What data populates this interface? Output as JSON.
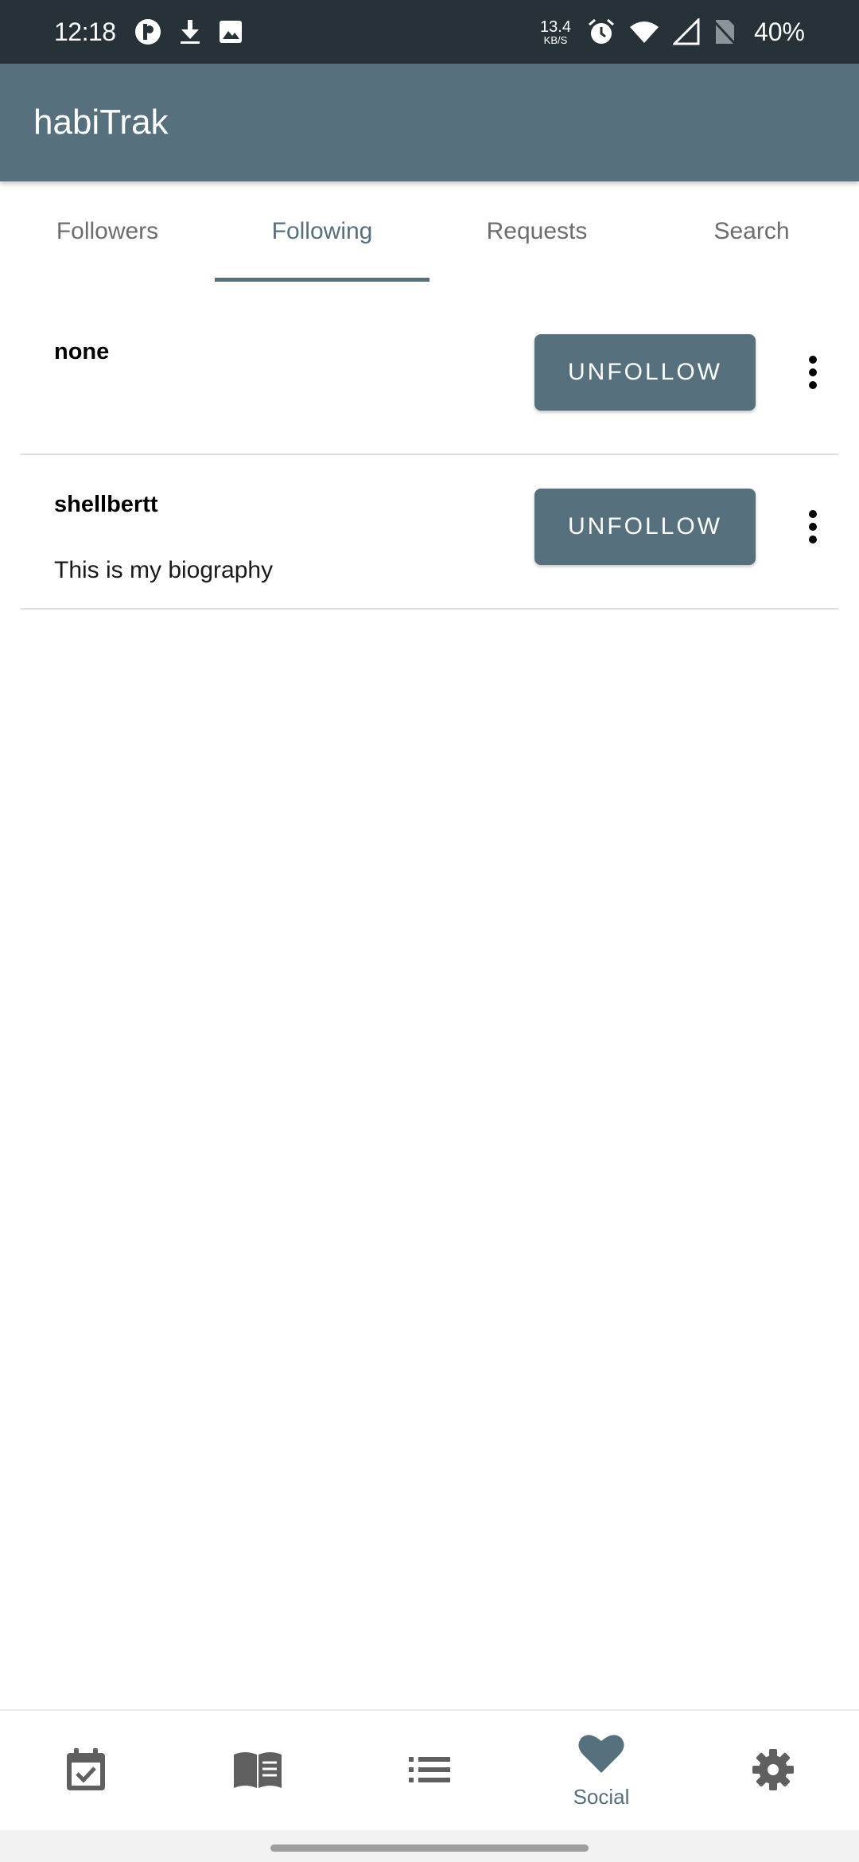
{
  "status_bar": {
    "time": "12:18",
    "net_speed_value": "13.4",
    "net_speed_unit": "KB/S",
    "battery": "40%",
    "icons": [
      "app-notification-icon",
      "download-icon",
      "image-icon",
      "alarm-icon",
      "wifi-icon",
      "signal-icon",
      "no-sim-icon"
    ]
  },
  "app_bar": {
    "title": "habiTrak"
  },
  "tabs": [
    {
      "label": "Followers",
      "active": false
    },
    {
      "label": "Following",
      "active": true
    },
    {
      "label": "Requests",
      "active": false
    },
    {
      "label": "Search",
      "active": false
    }
  ],
  "following": [
    {
      "username": "none",
      "bio": "",
      "action_label": "UNFOLLOW"
    },
    {
      "username": "shellbertt",
      "bio": "This is my biography",
      "action_label": "UNFOLLOW"
    }
  ],
  "bottom_nav": [
    {
      "icon": "calendar-check-icon",
      "label": "",
      "active": false
    },
    {
      "icon": "book-icon",
      "label": "",
      "active": false
    },
    {
      "icon": "list-icon",
      "label": "",
      "active": false
    },
    {
      "icon": "heart-icon",
      "label": "Social",
      "active": true
    },
    {
      "icon": "gear-icon",
      "label": "",
      "active": false
    }
  ],
  "colors": {
    "status_bar": "#263238",
    "primary": "#56707d",
    "nav_icon_inactive": "#5f5f5f"
  }
}
